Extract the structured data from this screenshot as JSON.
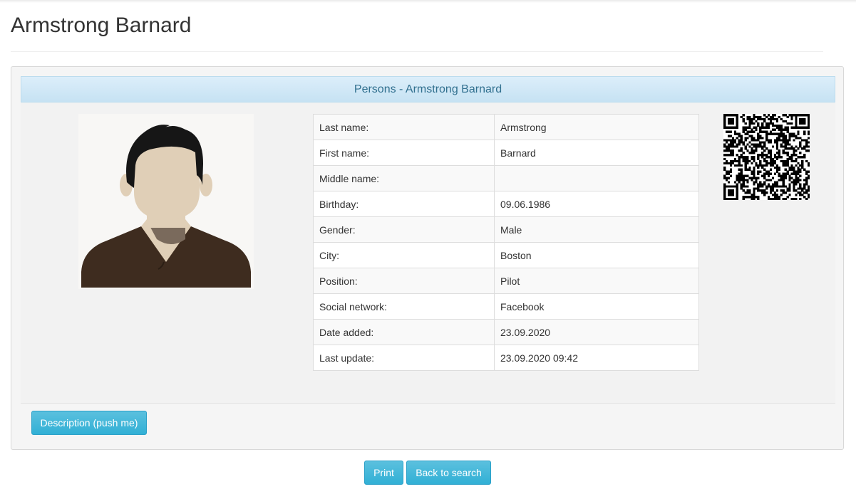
{
  "page": {
    "title": "Armstrong Barnard"
  },
  "panel": {
    "heading": "Persons - Armstrong Barnard"
  },
  "person": {
    "rows": [
      {
        "label": "Last name:",
        "value": "Armstrong"
      },
      {
        "label": "First name:",
        "value": "Barnard"
      },
      {
        "label": "Middle name:",
        "value": ""
      },
      {
        "label": "Birthday:",
        "value": "09.06.1986"
      },
      {
        "label": "Gender:",
        "value": "Male"
      },
      {
        "label": "City:",
        "value": "Boston"
      },
      {
        "label": "Position:",
        "value": "Pilot"
      },
      {
        "label": "Social network:",
        "value": "Facebook"
      },
      {
        "label": "Date added:",
        "value": "23.09.2020"
      },
      {
        "label": "Last update:",
        "value": "23.09.2020 09:42"
      }
    ]
  },
  "icons": {
    "photo": "person-avatar-icon",
    "qr": "qr-code-icon"
  },
  "buttons": {
    "description": "Description (push me)",
    "print": "Print",
    "back": "Back to search"
  },
  "colors": {
    "button": "#5bc0de",
    "heading_bg": "#d4e9f7",
    "heading_text": "#31708f"
  }
}
